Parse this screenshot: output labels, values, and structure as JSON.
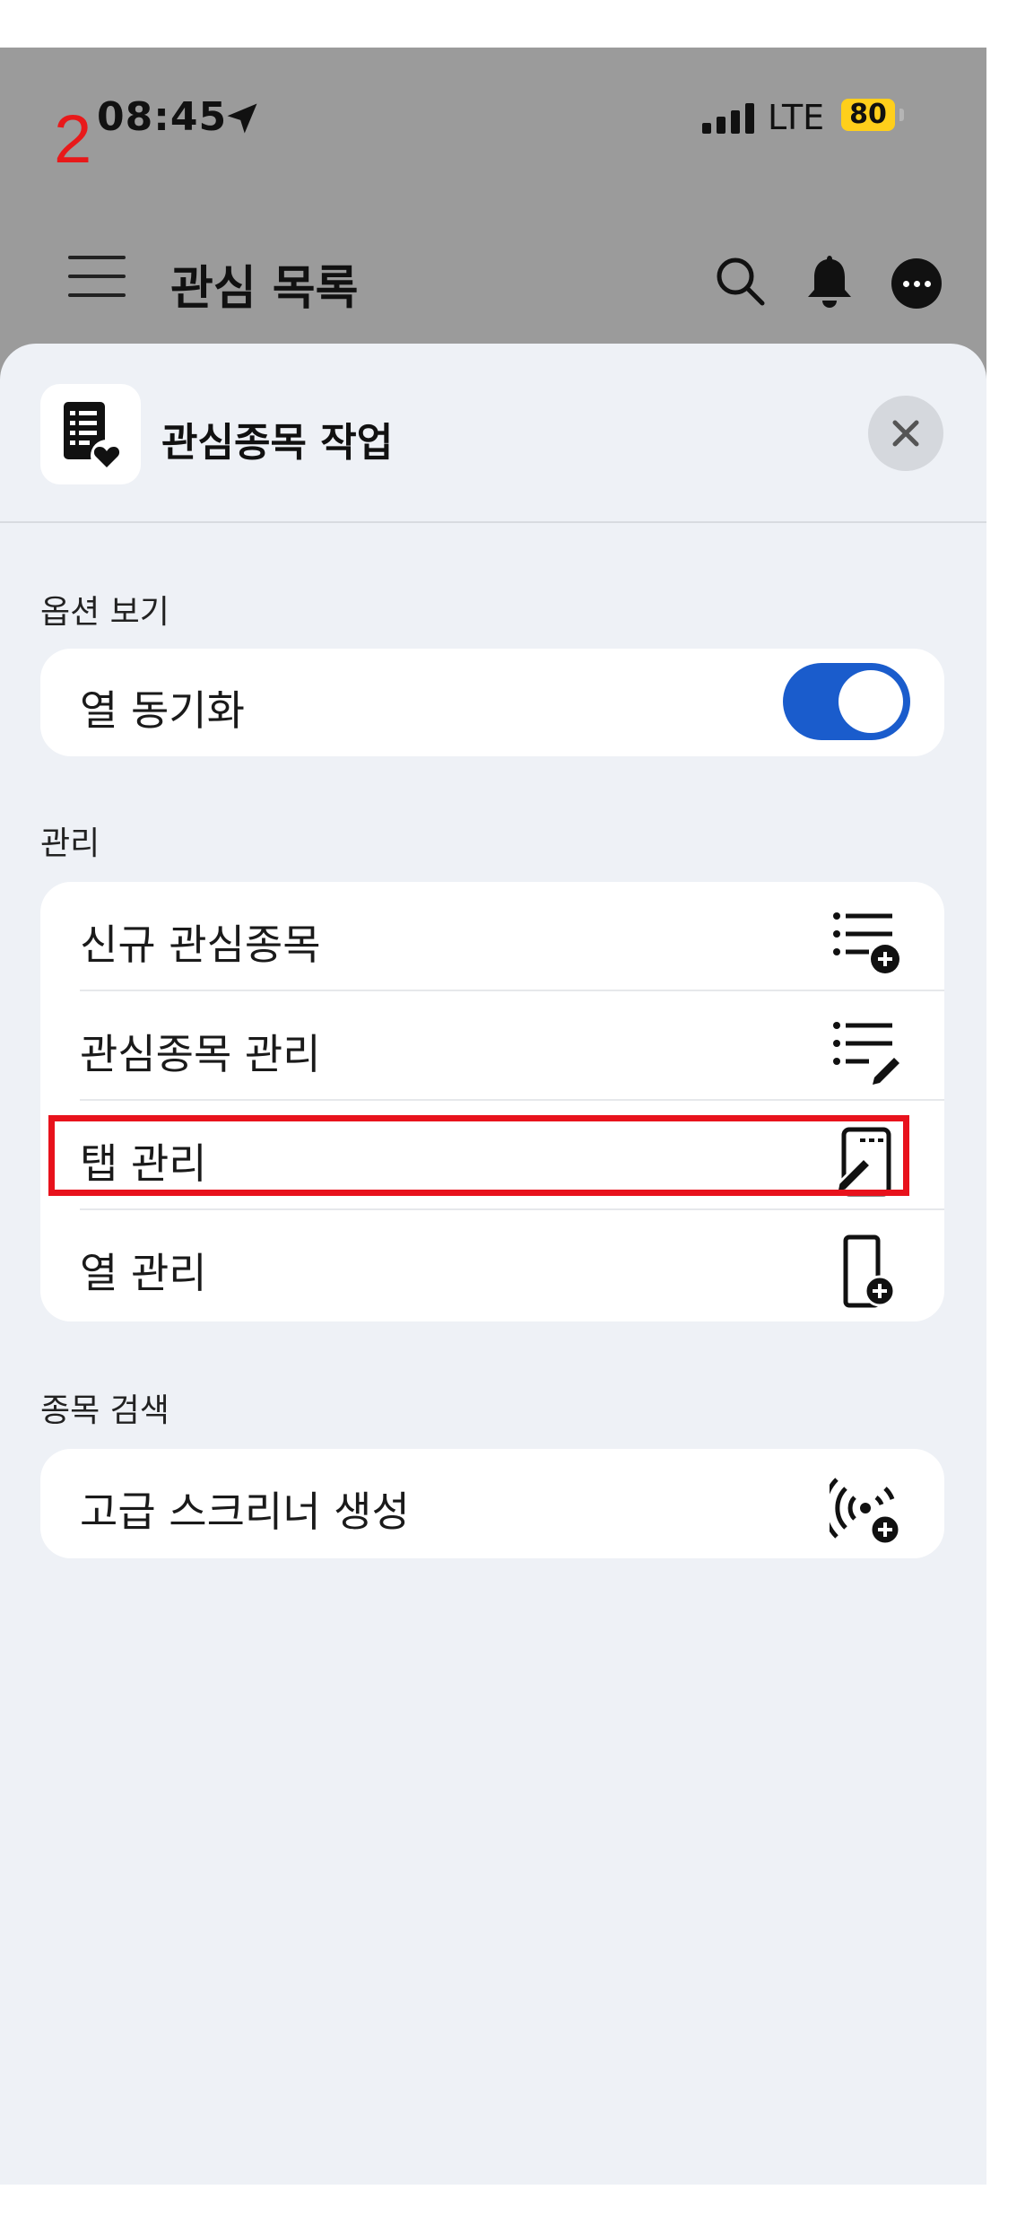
{
  "annotation": {
    "step_number": "2"
  },
  "status_bar": {
    "time": "08:45",
    "network": "LTE",
    "battery": "80"
  },
  "header": {
    "title": "관심 목록"
  },
  "sheet": {
    "title": "관심종목 작업",
    "sections": [
      {
        "label": "옵션 보기",
        "items": [
          {
            "label": "열 동기화",
            "toggle_on": true
          }
        ]
      },
      {
        "label": "관리",
        "items": [
          {
            "label": "신규 관심종목",
            "icon": "list-add-icon"
          },
          {
            "label": "관심종목 관리",
            "icon": "list-edit-icon"
          },
          {
            "label": "탭 관리",
            "icon": "tab-edit-icon",
            "highlighted": true
          },
          {
            "label": "열 관리",
            "icon": "column-add-icon"
          }
        ]
      },
      {
        "label": "종목 검색",
        "items": [
          {
            "label": "고급 스크리너 생성",
            "icon": "broadcast-add-icon"
          }
        ]
      }
    ]
  },
  "colors": {
    "toggle_on": "#1a5ccc",
    "highlight": "#e8121c",
    "battery": "#ffcf1b",
    "overlay": "#9b9b9b",
    "sheet_bg": "#eef1f6"
  }
}
